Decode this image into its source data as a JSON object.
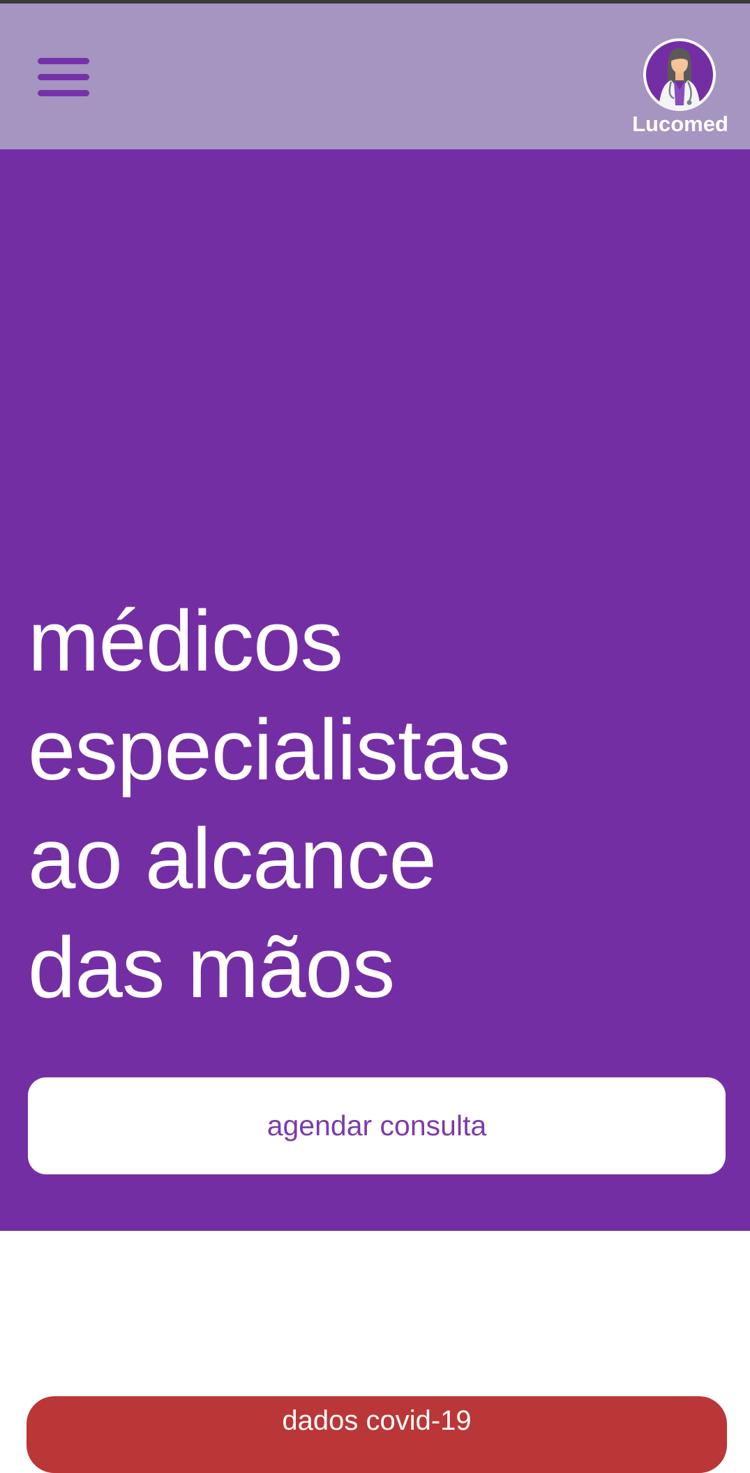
{
  "header": {
    "menu_icon": "hamburger-menu-icon",
    "brand_name": "Lucomed",
    "avatar_icon": "female-doctor-avatar-icon"
  },
  "hero": {
    "title_lines": [
      "médicos",
      "especialistas",
      "ao alcance",
      "das mãos"
    ],
    "cta_label": "agendar consulta"
  },
  "covid": {
    "button_label": "dados covid-19"
  },
  "colors": {
    "header_bg": "#a694c1",
    "brand_purple": "#742ea4",
    "menu_icon": "#7432a8",
    "cta_text": "#7c3bab",
    "covid_red": "#bb3637",
    "white": "#ffffff"
  }
}
